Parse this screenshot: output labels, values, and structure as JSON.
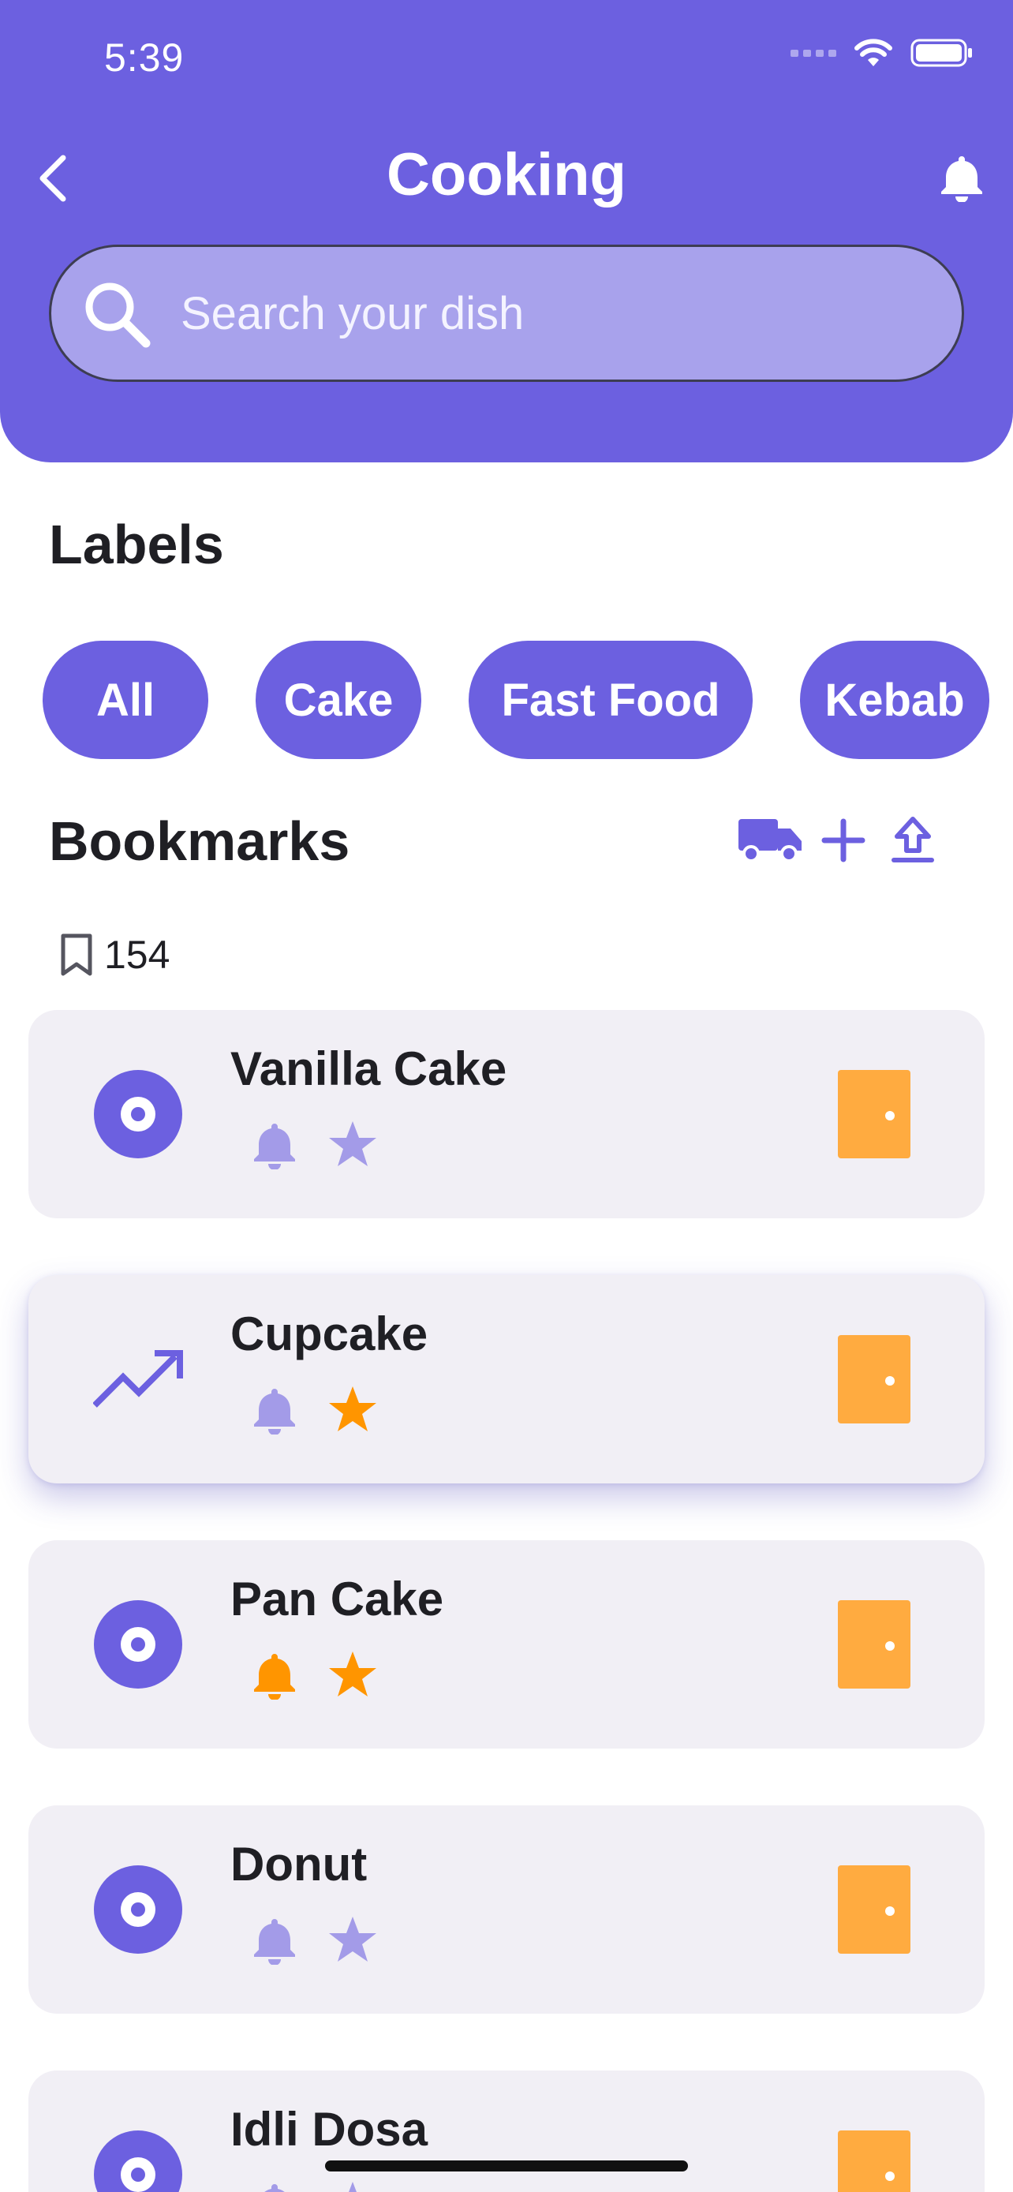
{
  "status_bar": {
    "time": "5:39"
  },
  "header": {
    "title": "Cooking"
  },
  "search": {
    "placeholder": "Search your dish"
  },
  "labels": {
    "title": "Labels",
    "chips": [
      "All",
      "Cake",
      "Fast Food",
      "Kebab"
    ]
  },
  "bookmarks": {
    "title": "Bookmarks",
    "count": "154",
    "items": [
      {
        "name": "Vanilla Cake",
        "icon": "disc-icon",
        "bell_active": false,
        "star_active": false
      },
      {
        "name": "Cupcake",
        "icon": "trending-up-icon",
        "bell_active": false,
        "star_active": true
      },
      {
        "name": "Pan Cake",
        "icon": "disc-icon",
        "bell_active": true,
        "star_active": true
      },
      {
        "name": "Donut",
        "icon": "disc-icon",
        "bell_active": false,
        "star_active": false
      },
      {
        "name": "Idli Dosa",
        "icon": "disc-icon",
        "bell_active": false,
        "star_active": false
      }
    ]
  },
  "colors": {
    "primary": "#6c60e0",
    "muted_icon": "#a39be8",
    "accent": "#ff9500",
    "door": "#ffab40",
    "card_bg": "#f1eff5"
  }
}
